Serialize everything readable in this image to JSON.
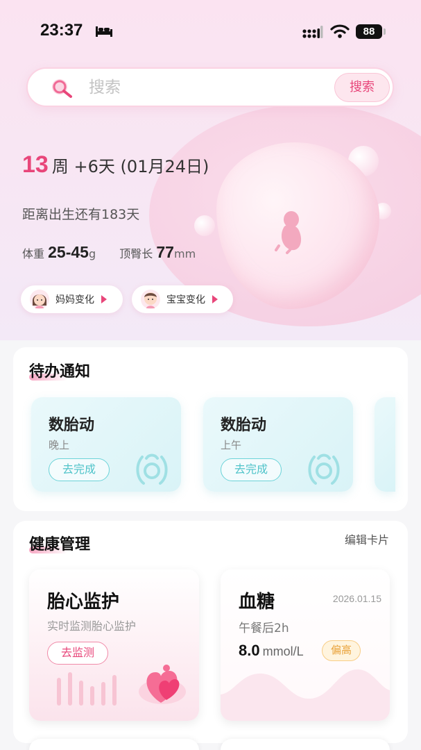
{
  "status_bar": {
    "time": "23:37",
    "battery": "88"
  },
  "search": {
    "placeholder": "搜索",
    "button_label": "搜索"
  },
  "pregnancy": {
    "week_number": "13",
    "week_suffix": "周 +6天 (01月24日)",
    "days_left": "距离出生还有183天",
    "weight_label": "体重",
    "weight_value": "25-45",
    "weight_unit": "g",
    "length_label": "顶臀长",
    "length_value": "77",
    "length_unit": "mm",
    "mom_change": "妈妈变化",
    "baby_change": "宝宝变化"
  },
  "todo": {
    "title": "待办通知",
    "items": [
      {
        "title": "数胎动",
        "subtitle": "晚上",
        "button": "去完成"
      },
      {
        "title": "数胎动",
        "subtitle": "上午",
        "button": "去完成"
      }
    ]
  },
  "health": {
    "title": "健康管理",
    "edit_label": "编辑卡片",
    "fetal_monitor": {
      "title": "胎心监护",
      "subtitle": "实时监测胎心监护",
      "button": "去监测"
    },
    "glucose": {
      "title": "血糖",
      "date": "2026.01.15",
      "subtitle": "午餐后2h",
      "value": "8.0",
      "unit": "mmol/L",
      "badge": "偏高"
    }
  },
  "colors": {
    "accent": "#e8467a",
    "teal": "#4fc3c9",
    "warning": "#e9a23a"
  }
}
